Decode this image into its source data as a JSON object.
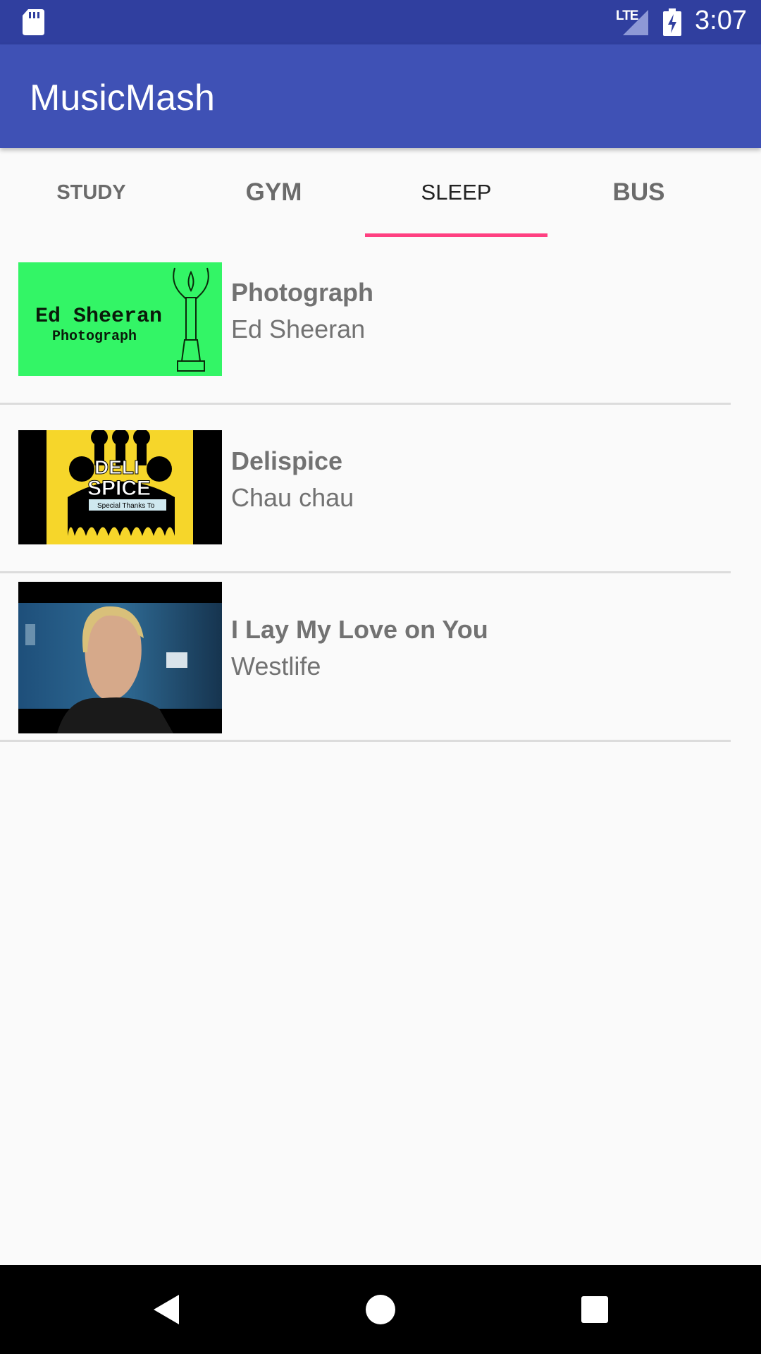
{
  "status_bar": {
    "network": "LTE",
    "time": "3:07"
  },
  "app": {
    "title": "MusicMash"
  },
  "tabs": [
    {
      "label": "STUDY",
      "selected": false
    },
    {
      "label": "GYM",
      "selected": false
    },
    {
      "label": "SLEEP",
      "selected": true
    },
    {
      "label": "BUS",
      "selected": false
    }
  ],
  "songs": [
    {
      "title": "Photograph",
      "artist": "Ed Sheeran",
      "art_text_line1": "Ed Sheeran",
      "art_text_line2": "Photograph"
    },
    {
      "title": "Delispice",
      "artist": "Chau chau",
      "art_text_line1": "DELI",
      "art_text_line2": "SPICE",
      "art_text_line3": "Special Thanks To"
    },
    {
      "title": "I Lay My Love on You",
      "artist": "Westlife"
    }
  ],
  "colors": {
    "status_bar": "#303f9f",
    "app_bar": "#3f51b5",
    "tab_indicator": "#ff4081"
  },
  "nav": {
    "back": "back-icon",
    "home": "home-icon",
    "recents": "recents-icon"
  }
}
